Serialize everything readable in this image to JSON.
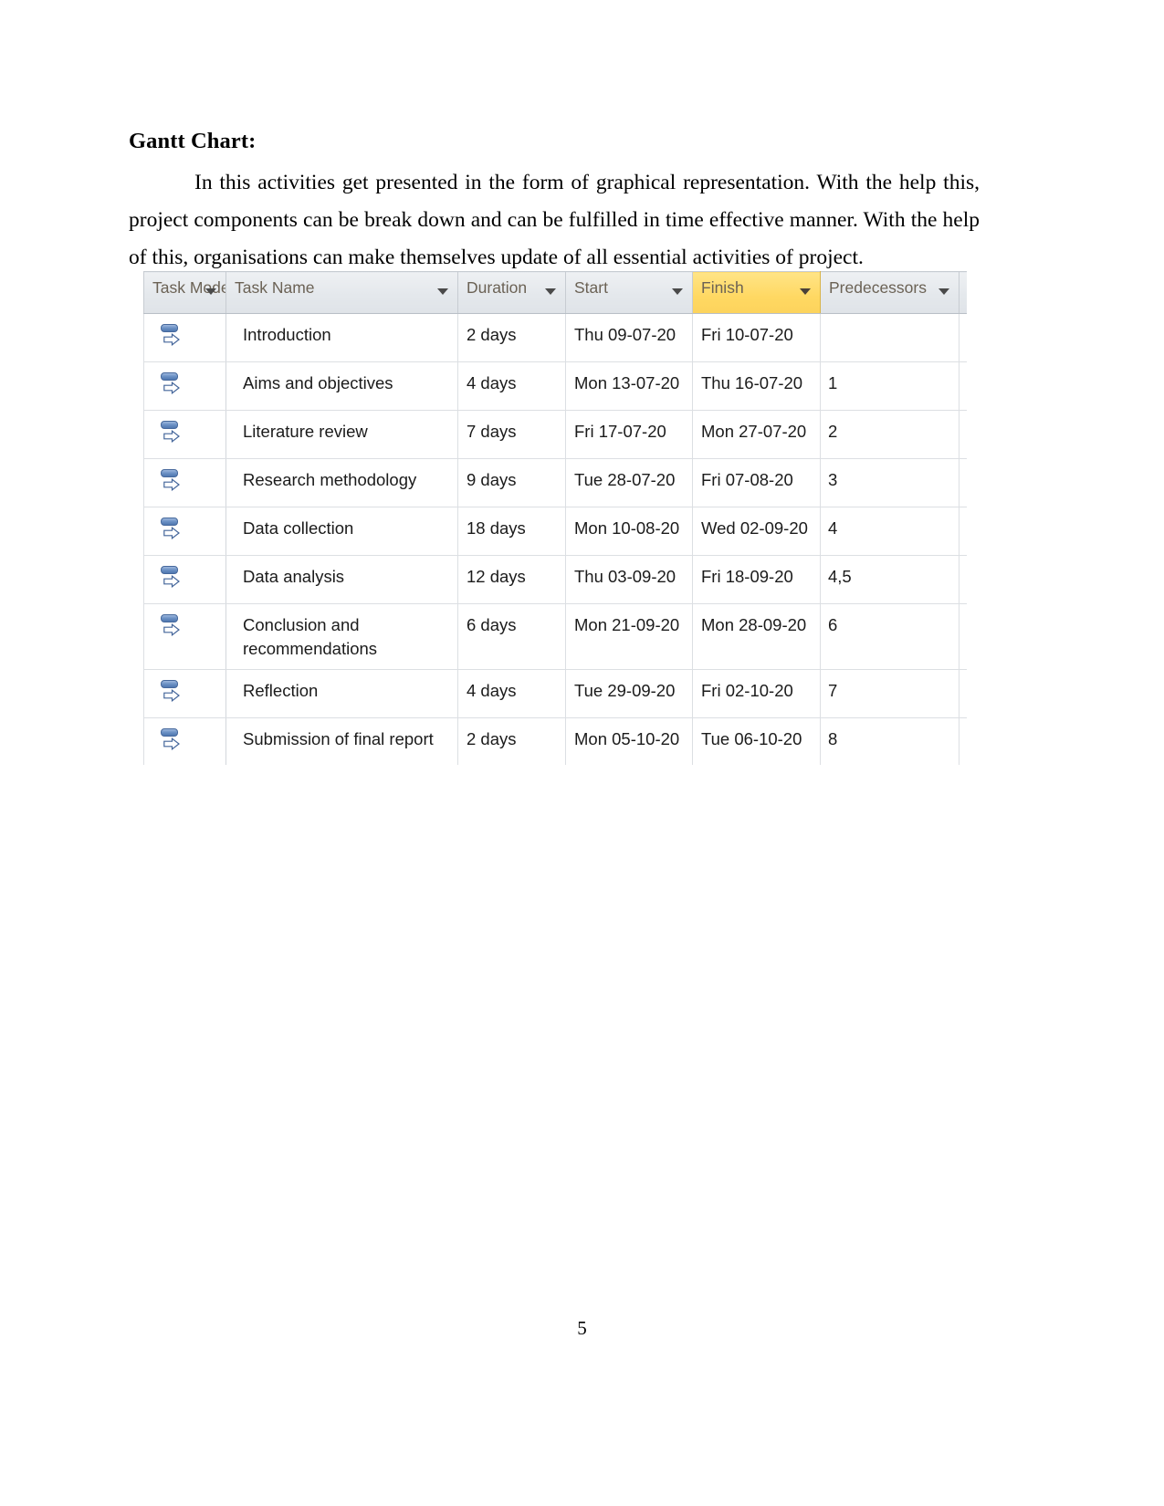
{
  "document": {
    "heading": "Gantt Chart:",
    "paragraph": "In this activities get presented in the form of graphical representation. With the help this, project components can be break down and can be fulfilled in time effective manner. With the help of this, organisations can make themselves update of all essential activities of project.",
    "page_number": "5"
  },
  "grid": {
    "highlight_color": "#ffd862",
    "header_bg_color": "#e4e8ec",
    "header_text_color": "#6b6255",
    "filter_icon": "chevron-down-icon",
    "task_mode_icon": "auto-scheduled-task-icon",
    "columns": [
      {
        "key": "mode",
        "label": "Task Mode",
        "highlighted": false,
        "has_filter": true
      },
      {
        "key": "name",
        "label": "Task Name",
        "highlighted": false,
        "has_filter": true
      },
      {
        "key": "dur",
        "label": "Duration",
        "highlighted": false,
        "has_filter": true
      },
      {
        "key": "start",
        "label": "Start",
        "highlighted": false,
        "has_filter": true
      },
      {
        "key": "fin",
        "label": "Finish",
        "highlighted": true,
        "has_filter": true
      },
      {
        "key": "pred",
        "label": "Predecessors",
        "highlighted": false,
        "has_filter": true
      }
    ],
    "rows": [
      {
        "mode": "auto-scheduled-task-icon",
        "name": "Introduction",
        "duration": "2 days",
        "start": "Thu 09-07-20",
        "finish": "Fri 10-07-20",
        "predecessors": ""
      },
      {
        "mode": "auto-scheduled-task-icon",
        "name": "Aims and objectives",
        "duration": "4 days",
        "start": "Mon 13-07-20",
        "finish": "Thu 16-07-20",
        "predecessors": "1"
      },
      {
        "mode": "auto-scheduled-task-icon",
        "name": "Literature review",
        "duration": "7 days",
        "start": "Fri 17-07-20",
        "finish": "Mon 27-07-20",
        "predecessors": "2"
      },
      {
        "mode": "auto-scheduled-task-icon",
        "name": "Research methodology",
        "duration": "9 days",
        "start": "Tue 28-07-20",
        "finish": "Fri 07-08-20",
        "predecessors": "3"
      },
      {
        "mode": "auto-scheduled-task-icon",
        "name": "Data collection",
        "duration": "18 days",
        "start": "Mon 10-08-20",
        "finish": "Wed 02-09-20",
        "predecessors": "4"
      },
      {
        "mode": "auto-scheduled-task-icon",
        "name": "Data analysis",
        "duration": "12 days",
        "start": "Thu 03-09-20",
        "finish": "Fri 18-09-20",
        "predecessors": "4,5"
      },
      {
        "mode": "auto-scheduled-task-icon",
        "name": "Conclusion and recommendations",
        "duration": "6 days",
        "start": "Mon 21-09-20",
        "finish": "Mon 28-09-20",
        "predecessors": "6"
      },
      {
        "mode": "auto-scheduled-task-icon",
        "name": "Reflection",
        "duration": "4 days",
        "start": "Tue 29-09-20",
        "finish": "Fri 02-10-20",
        "predecessors": "7"
      },
      {
        "mode": "auto-scheduled-task-icon",
        "name": "Submission of final report",
        "duration": "2 days",
        "start": "Mon 05-10-20",
        "finish": "Tue 06-10-20",
        "predecessors": "8"
      }
    ]
  },
  "chart_data": {
    "type": "table",
    "title": "Gantt Chart",
    "columns": [
      "Task Mode",
      "Task Name",
      "Duration",
      "Start",
      "Finish",
      "Predecessors"
    ],
    "rows": [
      [
        "auto",
        "Introduction",
        "2 days",
        "Thu 09-07-20",
        "Fri 10-07-20",
        ""
      ],
      [
        "auto",
        "Aims and objectives",
        "4 days",
        "Mon 13-07-20",
        "Thu 16-07-20",
        "1"
      ],
      [
        "auto",
        "Literature review",
        "7 days",
        "Fri 17-07-20",
        "Mon 27-07-20",
        "2"
      ],
      [
        "auto",
        "Research methodology",
        "9 days",
        "Tue 28-07-20",
        "Fri 07-08-20",
        "3"
      ],
      [
        "auto",
        "Data collection",
        "18 days",
        "Mon 10-08-20",
        "Wed 02-09-20",
        "4"
      ],
      [
        "auto",
        "Data analysis",
        "12 days",
        "Thu 03-09-20",
        "Fri 18-09-20",
        "4,5"
      ],
      [
        "auto",
        "Conclusion and recommendations",
        "6 days",
        "Mon 21-09-20",
        "Mon 28-09-20",
        "6"
      ],
      [
        "auto",
        "Reflection",
        "4 days",
        "Tue 29-09-20",
        "Fri 02-10-20",
        "7"
      ],
      [
        "auto",
        "Submission of final report",
        "2 days",
        "Mon 05-10-20",
        "Tue 06-10-20",
        "8"
      ]
    ],
    "durations_days": [
      2,
      4,
      7,
      9,
      18,
      12,
      6,
      4,
      2
    ],
    "highlighted_column": "Finish"
  }
}
